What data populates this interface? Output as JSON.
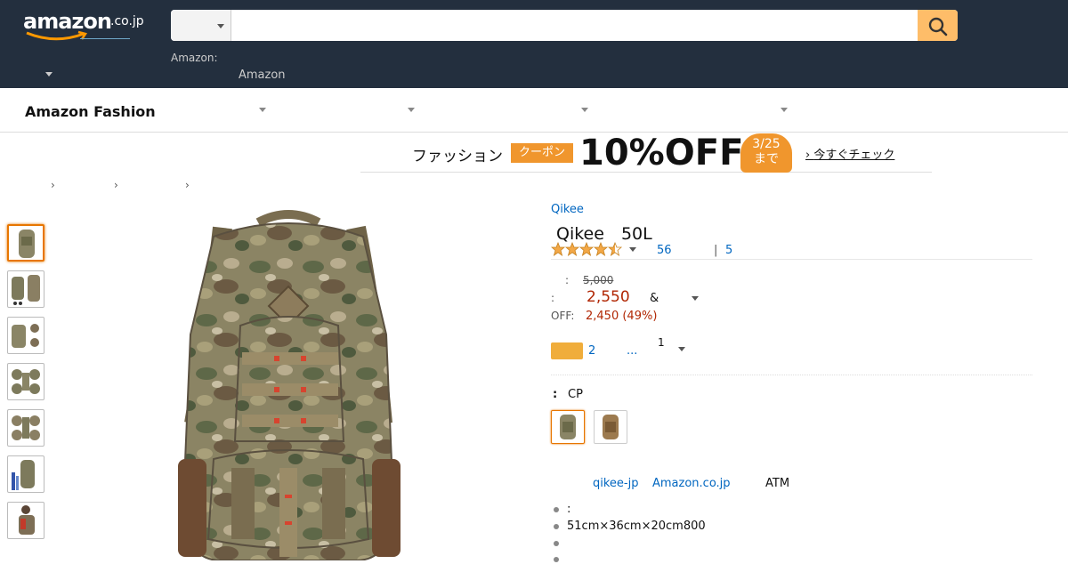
{
  "header": {
    "logo_text": "amazon",
    "logo_tld": ".co.jp",
    "search": {
      "category_label": "",
      "placeholder": "",
      "value": ""
    },
    "nav_sub_label": "Amazon:",
    "nav_amazon_label": "Amazon"
  },
  "fashion_nav": {
    "brand": "Amazon Fashion"
  },
  "banner": {
    "fashion_text": "ファッション",
    "coupon_label": "クーポン",
    "discount_text": "10%OFF",
    "date_line1": "3/25",
    "date_line2": "まで",
    "check_link": "今すぐチェック"
  },
  "breadcrumb": {
    "separators": [
      "›",
      "›",
      "›"
    ]
  },
  "product": {
    "brand": "Qikee",
    "title": "Qikee　50L",
    "rating_stars": 4.5,
    "ratings_count": "56",
    "separator": "|",
    "answered_count": "5",
    "list_price_label": ":",
    "list_price": "5,000",
    "price_label": ":",
    "price": "2,550",
    "price_suffix": "&",
    "savings_label": "OFF:",
    "savings": "2,450 (49%)",
    "prime_count": "2",
    "more_link": "...",
    "quantity": "1",
    "color_label": ":",
    "color_value": "CP",
    "seller_name": "qikee-jp",
    "fulfilled_by": "Amazon.co.jp",
    "payment_text": "ATM",
    "bullets": [
      ":",
      "51cm×36cm×20cm800",
      "",
      ""
    ]
  },
  "colors": {
    "header_bg": "#232f3e",
    "search_button": "#febd69",
    "link": "#0066c0",
    "price": "#b12704",
    "accent": "#f0962d"
  }
}
